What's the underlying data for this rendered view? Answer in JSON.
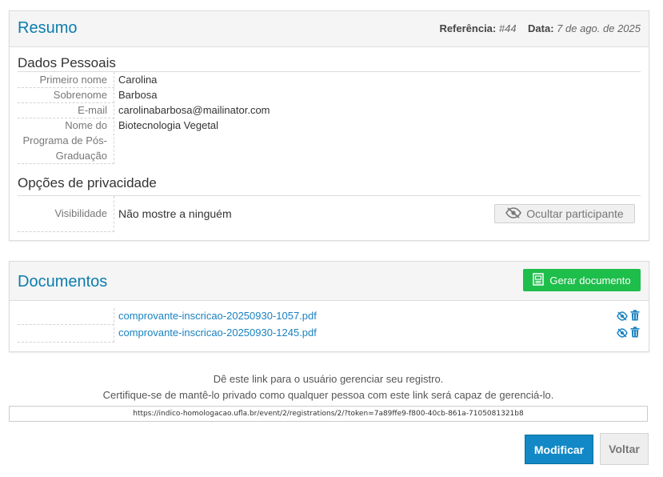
{
  "summary": {
    "title": "Resumo",
    "reference_label": "Referência:",
    "reference_value": "#44",
    "date_label": "Data:",
    "date_value": "7 de ago. de 2025",
    "personal_section": "Dados Pessoais",
    "fields": [
      {
        "label": "Primeiro nome",
        "value": "Carolina"
      },
      {
        "label": "Sobrenome",
        "value": "Barbosa"
      },
      {
        "label": "E-mail",
        "value": "carolinabarbosa@mailinator.com"
      },
      {
        "label_lines": [
          "Nome do",
          "Programa de Pós-",
          "Graduação"
        ],
        "value": "Biotecnologia Vegetal"
      }
    ],
    "privacy_section": "Opções de privacidade",
    "visibility_label": "Visibilidade",
    "visibility_value": "Não mostre a ninguém",
    "hide_button": "Ocultar participante"
  },
  "documents": {
    "title": "Documentos",
    "generate_button": "Gerar documento",
    "files": [
      "comprovante-inscricao-20250930-1057.pdf",
      "comprovante-inscricao-20250930-1245.pdf"
    ]
  },
  "manage_link": {
    "line1": "Dê este link para o usuário gerenciar seu registro.",
    "line2": "Certifique-se de mantê-lo privado como qualquer pessoa com este link será capaz de gerenciá-lo.",
    "url": "https://indico-homologacao.ufla.br/event/2/registrations/2/?token=7a89ffe9-f800-40cb-861a-7105081321b8"
  },
  "actions": {
    "modify": "Modificar",
    "back": "Voltar"
  },
  "colors": {
    "accent": "#0b7dad",
    "generate_green": "#1ebe4b",
    "link_blue": "#1a82c0"
  },
  "icons": [
    "eye-slash-icon",
    "document-icon",
    "trash-icon"
  ]
}
